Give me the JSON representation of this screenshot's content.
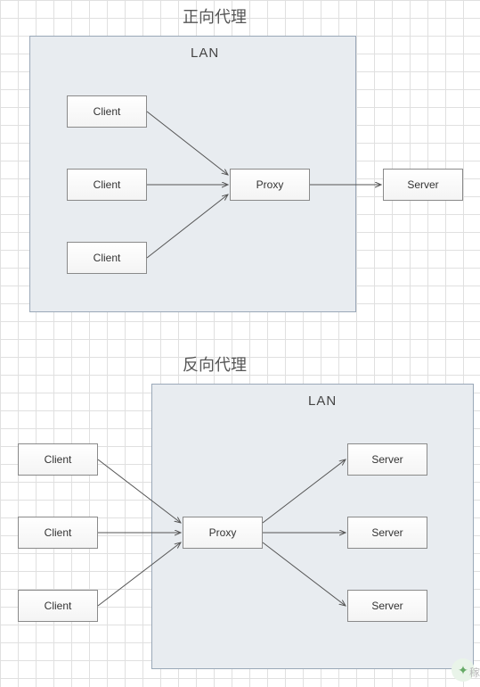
{
  "diagram1": {
    "title": "正向代理",
    "lan_label": "LAN",
    "clients": [
      "Client",
      "Client",
      "Client"
    ],
    "proxy": "Proxy",
    "server": "Server"
  },
  "diagram2": {
    "title": "反向代理",
    "lan_label": "LAN",
    "clients": [
      "Client",
      "Client",
      "Client"
    ],
    "proxy": "Proxy",
    "servers": [
      "Server",
      "Server",
      "Server"
    ]
  }
}
